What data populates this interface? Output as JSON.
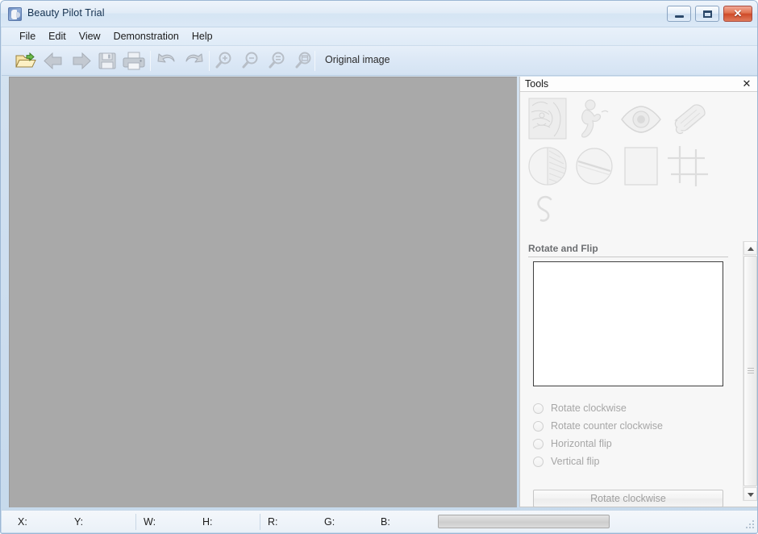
{
  "window": {
    "title": "Beauty Pilot Trial",
    "app_icon": "app-icon",
    "caption_buttons": {
      "minimize": "minimize-icon",
      "maximize": "maximize-icon",
      "close_label": "✕"
    },
    "accent_close_color": "#cf4a28",
    "frame_color": "#cfdff0"
  },
  "menubar": {
    "items": [
      {
        "label": "File"
      },
      {
        "label": "Edit"
      },
      {
        "label": "View"
      },
      {
        "label": "Demonstration"
      },
      {
        "label": "Help"
      }
    ]
  },
  "toolbar": {
    "buttons": [
      {
        "name": "open-file-button",
        "icon": "open-folder-icon",
        "enabled": true
      },
      {
        "name": "back-button",
        "icon": "arrow-left-icon",
        "enabled": false
      },
      {
        "name": "forward-button",
        "icon": "arrow-right-icon",
        "enabled": false
      },
      {
        "name": "save-button",
        "icon": "floppy-disk-icon",
        "enabled": false
      },
      {
        "name": "print-button",
        "icon": "printer-icon",
        "enabled": false
      },
      {
        "name": "undo-button",
        "icon": "undo-arrow-icon",
        "enabled": false
      },
      {
        "name": "redo-button",
        "icon": "redo-arrow-icon",
        "enabled": false
      },
      {
        "name": "zoom-in-button",
        "icon": "magnifier-plus-icon",
        "enabled": false
      },
      {
        "name": "zoom-out-button",
        "icon": "magnifier-minus-icon",
        "enabled": false
      },
      {
        "name": "zoom-actual-button",
        "icon": "magnifier-equal-icon",
        "enabled": false
      },
      {
        "name": "zoom-fit-button",
        "icon": "magnifier-fit-icon",
        "enabled": false
      }
    ],
    "original_image_label": "Original image"
  },
  "canvas": {
    "background_color": "#a9a9a9",
    "content": ""
  },
  "tools_panel": {
    "caption": "Tools",
    "close_label": "✕",
    "tools": [
      {
        "name": "tool-skin-texture",
        "icon": "face-texture-icon"
      },
      {
        "name": "tool-body-shape",
        "icon": "figure-icon"
      },
      {
        "name": "tool-red-eye",
        "icon": "eye-icon"
      },
      {
        "name": "tool-smoothing",
        "icon": "soap-bar-icon"
      },
      {
        "name": "tool-brightness",
        "icon": "half-shaded-circle-icon"
      },
      {
        "name": "tool-color-balance",
        "icon": "circle-diagonal-icon"
      },
      {
        "name": "tool-resize",
        "icon": "rectangle-icon"
      },
      {
        "name": "tool-crop",
        "icon": "crop-grid-icon"
      },
      {
        "name": "tool-warp",
        "icon": "squiggle-curve-icon"
      }
    ],
    "section": {
      "header": "Rotate and Flip",
      "options": [
        {
          "label": "Rotate clockwise",
          "selected": false,
          "enabled": false
        },
        {
          "label": "Rotate counter clockwise",
          "selected": false,
          "enabled": false
        },
        {
          "label": "Horizontal flip",
          "selected": false,
          "enabled": false
        },
        {
          "label": "Vertical flip",
          "selected": false,
          "enabled": false
        }
      ],
      "action_button": "Rotate clockwise"
    },
    "scrollbar": {
      "up_arrow": "scroll-up-icon",
      "down_arrow": "scroll-down-icon"
    }
  },
  "statusbar": {
    "panes": [
      {
        "name": "status-x",
        "label": "X:",
        "value": ""
      },
      {
        "name": "status-y",
        "label": "Y:",
        "value": ""
      },
      {
        "name": "status-w",
        "label": "W:",
        "value": ""
      },
      {
        "name": "status-h",
        "label": "H:",
        "value": ""
      },
      {
        "name": "status-r",
        "label": "R:",
        "value": ""
      },
      {
        "name": "status-g",
        "label": "G:",
        "value": ""
      },
      {
        "name": "status-b",
        "label": "B:",
        "value": ""
      }
    ],
    "progress_percent": 0
  }
}
